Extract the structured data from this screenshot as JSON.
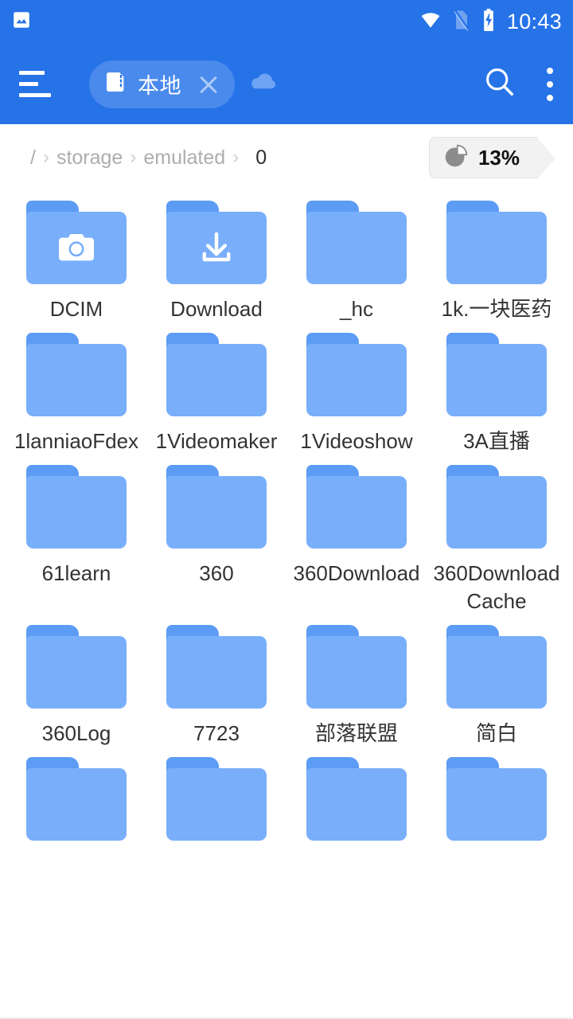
{
  "statusbar": {
    "time": "10:43",
    "icons": [
      "gallery-notification-icon",
      "wifi-icon",
      "no-sim-icon",
      "battery-charging-icon"
    ]
  },
  "appbar": {
    "menu_icon": "hamburger-menu-icon",
    "tab": {
      "icon": "sd-card-icon",
      "label": "本地",
      "close_icon": "close-icon"
    },
    "cloud_icon": "cloud-icon",
    "search_icon": "search-icon",
    "overflow_icon": "overflow-menu-icon"
  },
  "breadcrumb": {
    "root": "/",
    "segments": [
      "storage",
      "emulated",
      "0"
    ],
    "separator": "›"
  },
  "storage": {
    "percent_label": "13%",
    "icon": "pie-chart-icon"
  },
  "colors": {
    "header_blue": "#2673e8",
    "folder_body": "#79aefb",
    "folder_tab": "#5c9cf5",
    "label_text": "#333333",
    "crumb_muted": "#adadad",
    "badge_bg": "#f2f2f2"
  },
  "files": [
    {
      "name": "DCIM",
      "glyph": "camera-icon"
    },
    {
      "name": "Download",
      "glyph": "download-icon"
    },
    {
      "name": "_hc",
      "glyph": ""
    },
    {
      "name": "1k.一块医药",
      "glyph": ""
    },
    {
      "name": "1lanniaoFdex",
      "glyph": ""
    },
    {
      "name": "1Videomaker",
      "glyph": ""
    },
    {
      "name": "1Videoshow",
      "glyph": ""
    },
    {
      "name": "3A直播",
      "glyph": ""
    },
    {
      "name": "61learn",
      "glyph": ""
    },
    {
      "name": "360",
      "glyph": ""
    },
    {
      "name": "360Download",
      "glyph": ""
    },
    {
      "name": "360DownloadCache",
      "glyph": ""
    },
    {
      "name": "360Log",
      "glyph": ""
    },
    {
      "name": "7723",
      "glyph": ""
    },
    {
      "name": "部落联盟",
      "glyph": ""
    },
    {
      "name": "简白",
      "glyph": ""
    },
    {
      "name": "",
      "glyph": ""
    },
    {
      "name": "",
      "glyph": ""
    },
    {
      "name": "",
      "glyph": ""
    },
    {
      "name": "",
      "glyph": ""
    }
  ]
}
